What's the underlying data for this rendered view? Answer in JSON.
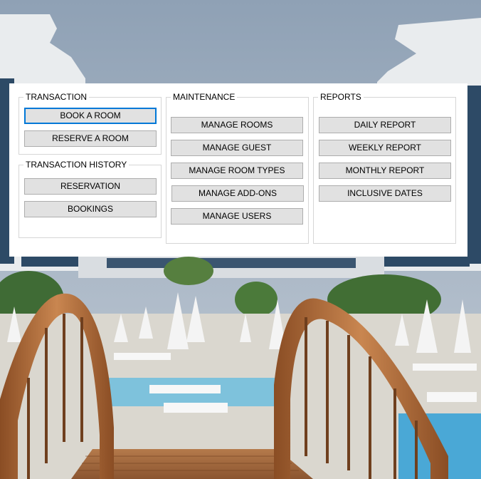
{
  "transaction": {
    "title": "TRANSACTION",
    "book_room": "BOOK A ROOM",
    "reserve_room": "RESERVE A ROOM"
  },
  "transaction_history": {
    "title": "TRANSACTION HISTORY",
    "reservation": "RESERVATION",
    "bookings": "BOOKINGS"
  },
  "maintenance": {
    "title": "MAINTENANCE",
    "manage_rooms": "MANAGE ROOMS",
    "manage_guest": "MANAGE GUEST",
    "manage_room_types": "MANAGE ROOM TYPES",
    "manage_addons": "MANAGE ADD-ONS",
    "manage_users": "MANAGE USERS"
  },
  "reports": {
    "title": "REPORTS",
    "daily": "DAILY REPORT",
    "weekly": "WEEKLY REPORT",
    "monthly": "MONTHLY REPORT",
    "inclusive": "INCLUSIVE DATES"
  },
  "colors": {
    "sky": "#a9b7c6",
    "building": "#eef1f2",
    "wood": "#b8723d",
    "pool": "#5fb3d8",
    "focus": "#0078d7"
  }
}
